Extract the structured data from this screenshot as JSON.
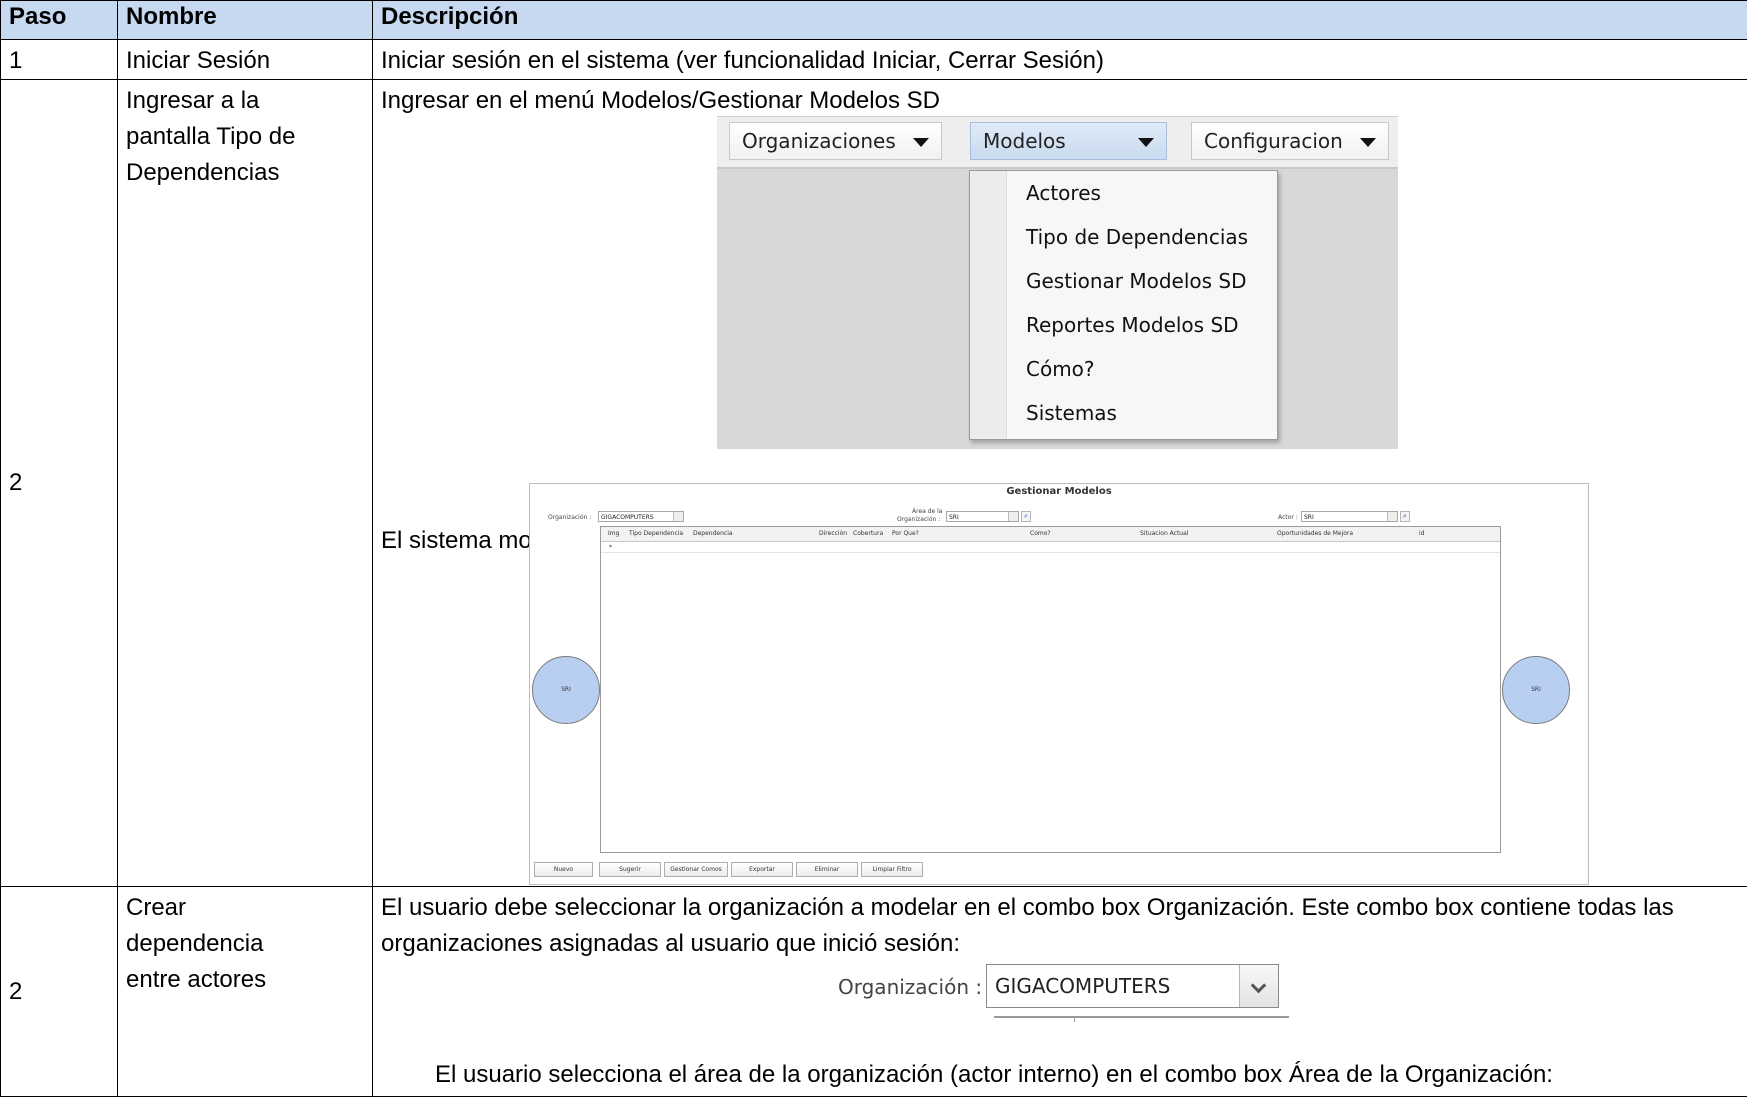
{
  "table": {
    "headers": [
      "Paso",
      "Nombre",
      "Descripción"
    ],
    "rows": [
      {
        "paso": "1",
        "nombre": "Iniciar Sesión",
        "descripcion": "Iniciar sesión en el sistema (ver funcionalidad Iniciar, Cerrar Sesión)"
      },
      {
        "paso": "2",
        "nombre": "Ingresar a la pantalla Tipo de Dependencias",
        "descripcion": "Ingresar en el menú Modelos/Gestionar Modelos SD",
        "descripcion2": "El sistema mostrará la siguiente pantalla:"
      },
      {
        "paso": "2",
        "nombre": "Crear dependencia entre actores",
        "descripcion": "El usuario debe seleccionar la organización a modelar en el combo box Organización. Este combo box contiene todas las organizaciones asignadas al usuario que inició sesión:",
        "descripcion2": "El usuario selecciona el área de la organización (actor interno) en el combo box Área de la Organización:"
      }
    ]
  },
  "menu_screenshot": {
    "menus": [
      "Organizaciones",
      "Modelos",
      "Configuracion"
    ],
    "dropdown_items": [
      "Actores",
      "Tipo de Dependencias",
      "Gestionar Modelos SD",
      "Reportes Modelos SD",
      "Cómo?",
      "Sistemas"
    ]
  },
  "gestionar_screenshot": {
    "title": "Gestionar Modelos",
    "organizacion_label": "Organización :",
    "organizacion_value": "GIGACOMPUTERS",
    "area_label_1": "Área de la",
    "area_label_2": "Organización :",
    "area_value": "SRI",
    "actor_label": "Actor :",
    "actor_value": "SRI",
    "columns": [
      "Img",
      "Tipo Dependencia",
      "Dependencia",
      "Dirección",
      "Cobertura",
      "Por Que?",
      "Como?",
      "Situacion Actual",
      "Oportunidades de Mejora",
      "id"
    ],
    "new_row_marker": "*",
    "left_actor": "SRI",
    "right_actor": "SRI",
    "buttons": [
      "Nuevo",
      "Sugerir",
      "Gestionar Comos",
      "Exportar",
      "Eliminar",
      "Limpiar Filtro"
    ]
  },
  "org_screenshot": {
    "label": "Organización :",
    "value": "GIGACOMPUTERS"
  }
}
